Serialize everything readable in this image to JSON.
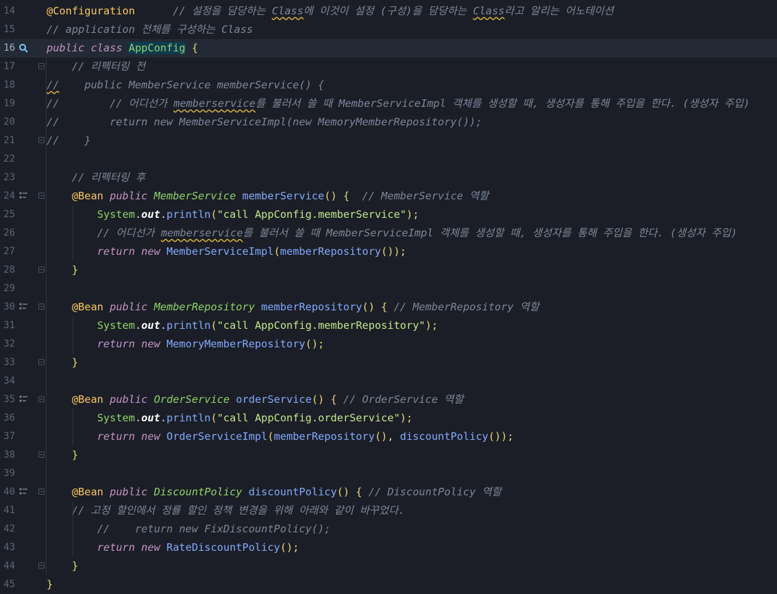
{
  "editor": {
    "lines": [
      {
        "n": "14",
        "parts": [
          [
            "ann",
            "@Configuration"
          ],
          [
            "plain",
            "      "
          ],
          [
            "cmt",
            "// "
          ],
          [
            "cmtk",
            "설정을 담당하는 "
          ],
          [
            "cmtw",
            "Class"
          ],
          [
            "cmtk",
            "에 이것이 설정 "
          ],
          [
            "cmt",
            "("
          ],
          [
            "cmtk",
            "구성"
          ],
          [
            "cmt",
            ")"
          ],
          [
            "cmtk",
            "을 담당하는 "
          ],
          [
            "cmtw",
            "Class"
          ],
          [
            "cmtk",
            "라고 알리는 어노테이션"
          ]
        ]
      },
      {
        "n": "15",
        "parts": [
          [
            "cmt",
            "// application "
          ],
          [
            "cmtk",
            "전체를 구성하는 "
          ],
          [
            "cmt",
            "Class"
          ]
        ]
      },
      {
        "n": "16",
        "current": true,
        "gutter": "bulb",
        "parts": [
          [
            "kw",
            "public class "
          ],
          [
            "caret",
            ""
          ],
          [
            "hlcls",
            "AppConfig"
          ],
          [
            "pn",
            " {"
          ]
        ]
      },
      {
        "n": "17",
        "fold": true,
        "parts": [
          [
            "plain",
            "    "
          ],
          [
            "cmt",
            "// "
          ],
          [
            "cmtk",
            "리펙터링 전"
          ]
        ]
      },
      {
        "n": "18",
        "parts": [
          [
            "cmtw",
            "//"
          ],
          [
            "cmt",
            "    public MemberService memberService() {"
          ]
        ]
      },
      {
        "n": "19",
        "parts": [
          [
            "cmt",
            "//        // "
          ],
          [
            "cmtk",
            "어디선가 "
          ],
          [
            "cmtw",
            "memberservice"
          ],
          [
            "cmtk",
            "를 불러서 쓸 때 "
          ],
          [
            "cmt",
            "MemberServiceImpl "
          ],
          [
            "cmtk",
            "객체를 생성할 때"
          ],
          [
            "cmt",
            ", "
          ],
          [
            "cmtk",
            "생성자를 통해 주입을 한다"
          ],
          [
            "cmt",
            ". ("
          ],
          [
            "cmtk",
            "생성자 주입"
          ],
          [
            "cmt",
            ")"
          ]
        ]
      },
      {
        "n": "20",
        "parts": [
          [
            "cmt",
            "//        return new MemberServiceImpl(new MemoryMemberRepository());"
          ]
        ]
      },
      {
        "n": "21",
        "fold": true,
        "parts": [
          [
            "cmt",
            "//    }"
          ]
        ]
      },
      {
        "n": "22",
        "parts": []
      },
      {
        "n": "23",
        "parts": [
          [
            "plain",
            "    "
          ],
          [
            "cmt",
            "// "
          ],
          [
            "cmtk",
            "리펙터링 후"
          ]
        ]
      },
      {
        "n": "24",
        "fold": true,
        "gutter": "bean",
        "parts": [
          [
            "plain",
            "    "
          ],
          [
            "ann",
            "@Bean "
          ],
          [
            "kw",
            "public "
          ],
          [
            "type",
            "MemberService "
          ],
          [
            "fn",
            "memberService"
          ],
          [
            "pn",
            "() {"
          ],
          [
            "plain",
            "  "
          ],
          [
            "cmt",
            "// MemberService "
          ],
          [
            "cmtk",
            "역할"
          ]
        ]
      },
      {
        "n": "25",
        "parts": [
          [
            "plain",
            "        "
          ],
          [
            "cls",
            "System"
          ],
          [
            "plain",
            "."
          ],
          [
            "field",
            "out"
          ],
          [
            "plain",
            "."
          ],
          [
            "fn",
            "println"
          ],
          [
            "pn",
            "("
          ],
          [
            "str",
            "\"call AppConfig.memberService\""
          ],
          [
            "pn",
            ");"
          ]
        ]
      },
      {
        "n": "26",
        "parts": [
          [
            "plain",
            "        "
          ],
          [
            "cmt",
            "// "
          ],
          [
            "cmtk",
            "어디선가 "
          ],
          [
            "cmtw",
            "memberservice"
          ],
          [
            "cmtk",
            "를 불러서 쓸 때 "
          ],
          [
            "cmt",
            "MemberServiceImpl "
          ],
          [
            "cmtk",
            "객체를 생성할 때"
          ],
          [
            "cmt",
            ", "
          ],
          [
            "cmtk",
            "생성자를 통해 주입을 한다"
          ],
          [
            "cmt",
            ". ("
          ],
          [
            "cmtk",
            "생성자 주입"
          ],
          [
            "cmt",
            ")"
          ]
        ]
      },
      {
        "n": "27",
        "parts": [
          [
            "plain",
            "        "
          ],
          [
            "kw",
            "return new "
          ],
          [
            "fn",
            "MemberServiceImpl"
          ],
          [
            "pn",
            "("
          ],
          [
            "fn",
            "memberRepository"
          ],
          [
            "pn",
            "());"
          ]
        ]
      },
      {
        "n": "28",
        "fold": true,
        "parts": [
          [
            "plain",
            "    "
          ],
          [
            "pn",
            "}"
          ]
        ]
      },
      {
        "n": "29",
        "parts": []
      },
      {
        "n": "30",
        "fold": true,
        "gutter": "bean",
        "parts": [
          [
            "plain",
            "    "
          ],
          [
            "ann",
            "@Bean "
          ],
          [
            "kw",
            "public "
          ],
          [
            "type",
            "MemberRepository "
          ],
          [
            "fn",
            "memberRepository"
          ],
          [
            "pn",
            "() { "
          ],
          [
            "cmt",
            "// MemberRepository "
          ],
          [
            "cmtk",
            "역할"
          ]
        ]
      },
      {
        "n": "31",
        "parts": [
          [
            "plain",
            "        "
          ],
          [
            "cls",
            "System"
          ],
          [
            "plain",
            "."
          ],
          [
            "field",
            "out"
          ],
          [
            "plain",
            "."
          ],
          [
            "fn",
            "println"
          ],
          [
            "pn",
            "("
          ],
          [
            "str",
            "\"call AppConfig.memberRepository\""
          ],
          [
            "pn",
            ");"
          ]
        ]
      },
      {
        "n": "32",
        "parts": [
          [
            "plain",
            "        "
          ],
          [
            "kw",
            "return new "
          ],
          [
            "fn",
            "MemoryMemberRepository"
          ],
          [
            "pn",
            "();"
          ]
        ]
      },
      {
        "n": "33",
        "fold": true,
        "parts": [
          [
            "plain",
            "    "
          ],
          [
            "pn",
            "}"
          ]
        ]
      },
      {
        "n": "34",
        "parts": []
      },
      {
        "n": "35",
        "fold": true,
        "gutter": "bean",
        "parts": [
          [
            "plain",
            "    "
          ],
          [
            "ann",
            "@Bean "
          ],
          [
            "kw",
            "public "
          ],
          [
            "type",
            "OrderService "
          ],
          [
            "fn",
            "orderService"
          ],
          [
            "pn",
            "() { "
          ],
          [
            "cmt",
            "// OrderService "
          ],
          [
            "cmtk",
            "역할"
          ]
        ]
      },
      {
        "n": "36",
        "parts": [
          [
            "plain",
            "        "
          ],
          [
            "cls",
            "System"
          ],
          [
            "plain",
            "."
          ],
          [
            "field",
            "out"
          ],
          [
            "plain",
            "."
          ],
          [
            "fn",
            "println"
          ],
          [
            "pn",
            "("
          ],
          [
            "str",
            "\"call AppConfig.orderService\""
          ],
          [
            "pn",
            ");"
          ]
        ]
      },
      {
        "n": "37",
        "parts": [
          [
            "plain",
            "        "
          ],
          [
            "kw",
            "return new "
          ],
          [
            "fn",
            "OrderServiceImpl"
          ],
          [
            "pn",
            "("
          ],
          [
            "fn",
            "memberRepository"
          ],
          [
            "pn",
            "(), "
          ],
          [
            "fn",
            "discountPolicy"
          ],
          [
            "pn",
            "());"
          ]
        ]
      },
      {
        "n": "38",
        "fold": true,
        "parts": [
          [
            "plain",
            "    "
          ],
          [
            "pn",
            "}"
          ]
        ]
      },
      {
        "n": "39",
        "parts": []
      },
      {
        "n": "40",
        "fold": true,
        "gutter": "bean",
        "parts": [
          [
            "plain",
            "    "
          ],
          [
            "ann",
            "@Bean "
          ],
          [
            "kw",
            "public "
          ],
          [
            "type",
            "DiscountPolicy "
          ],
          [
            "fn",
            "discountPolicy"
          ],
          [
            "pn",
            "() { "
          ],
          [
            "cmt",
            "// DiscountPolicy "
          ],
          [
            "cmtk",
            "역할"
          ]
        ]
      },
      {
        "n": "41",
        "parts": [
          [
            "plain",
            "    "
          ],
          [
            "cmt",
            "// "
          ],
          [
            "cmtk",
            "고정 할인에서 정률 할인 정책 변경을 위해 아래와 같이 바꾸었다"
          ],
          [
            "cmt",
            "."
          ]
        ]
      },
      {
        "n": "42",
        "parts": [
          [
            "plain",
            "        "
          ],
          [
            "cmt",
            "//    return new FixDiscountPolicy();"
          ]
        ]
      },
      {
        "n": "43",
        "parts": [
          [
            "plain",
            "        "
          ],
          [
            "kw",
            "return new "
          ],
          [
            "fn",
            "RateDiscountPolicy"
          ],
          [
            "pn",
            "();"
          ]
        ]
      },
      {
        "n": "44",
        "fold": true,
        "parts": [
          [
            "plain",
            "    "
          ],
          [
            "pn",
            "}"
          ]
        ]
      },
      {
        "n": "45",
        "parts": [
          [
            "pn",
            "}"
          ]
        ]
      }
    ]
  },
  "icons": {
    "bulb": "code-vision-bulb-icon",
    "bean": "spring-bean-icon",
    "fold": "fold-marker-icon"
  }
}
